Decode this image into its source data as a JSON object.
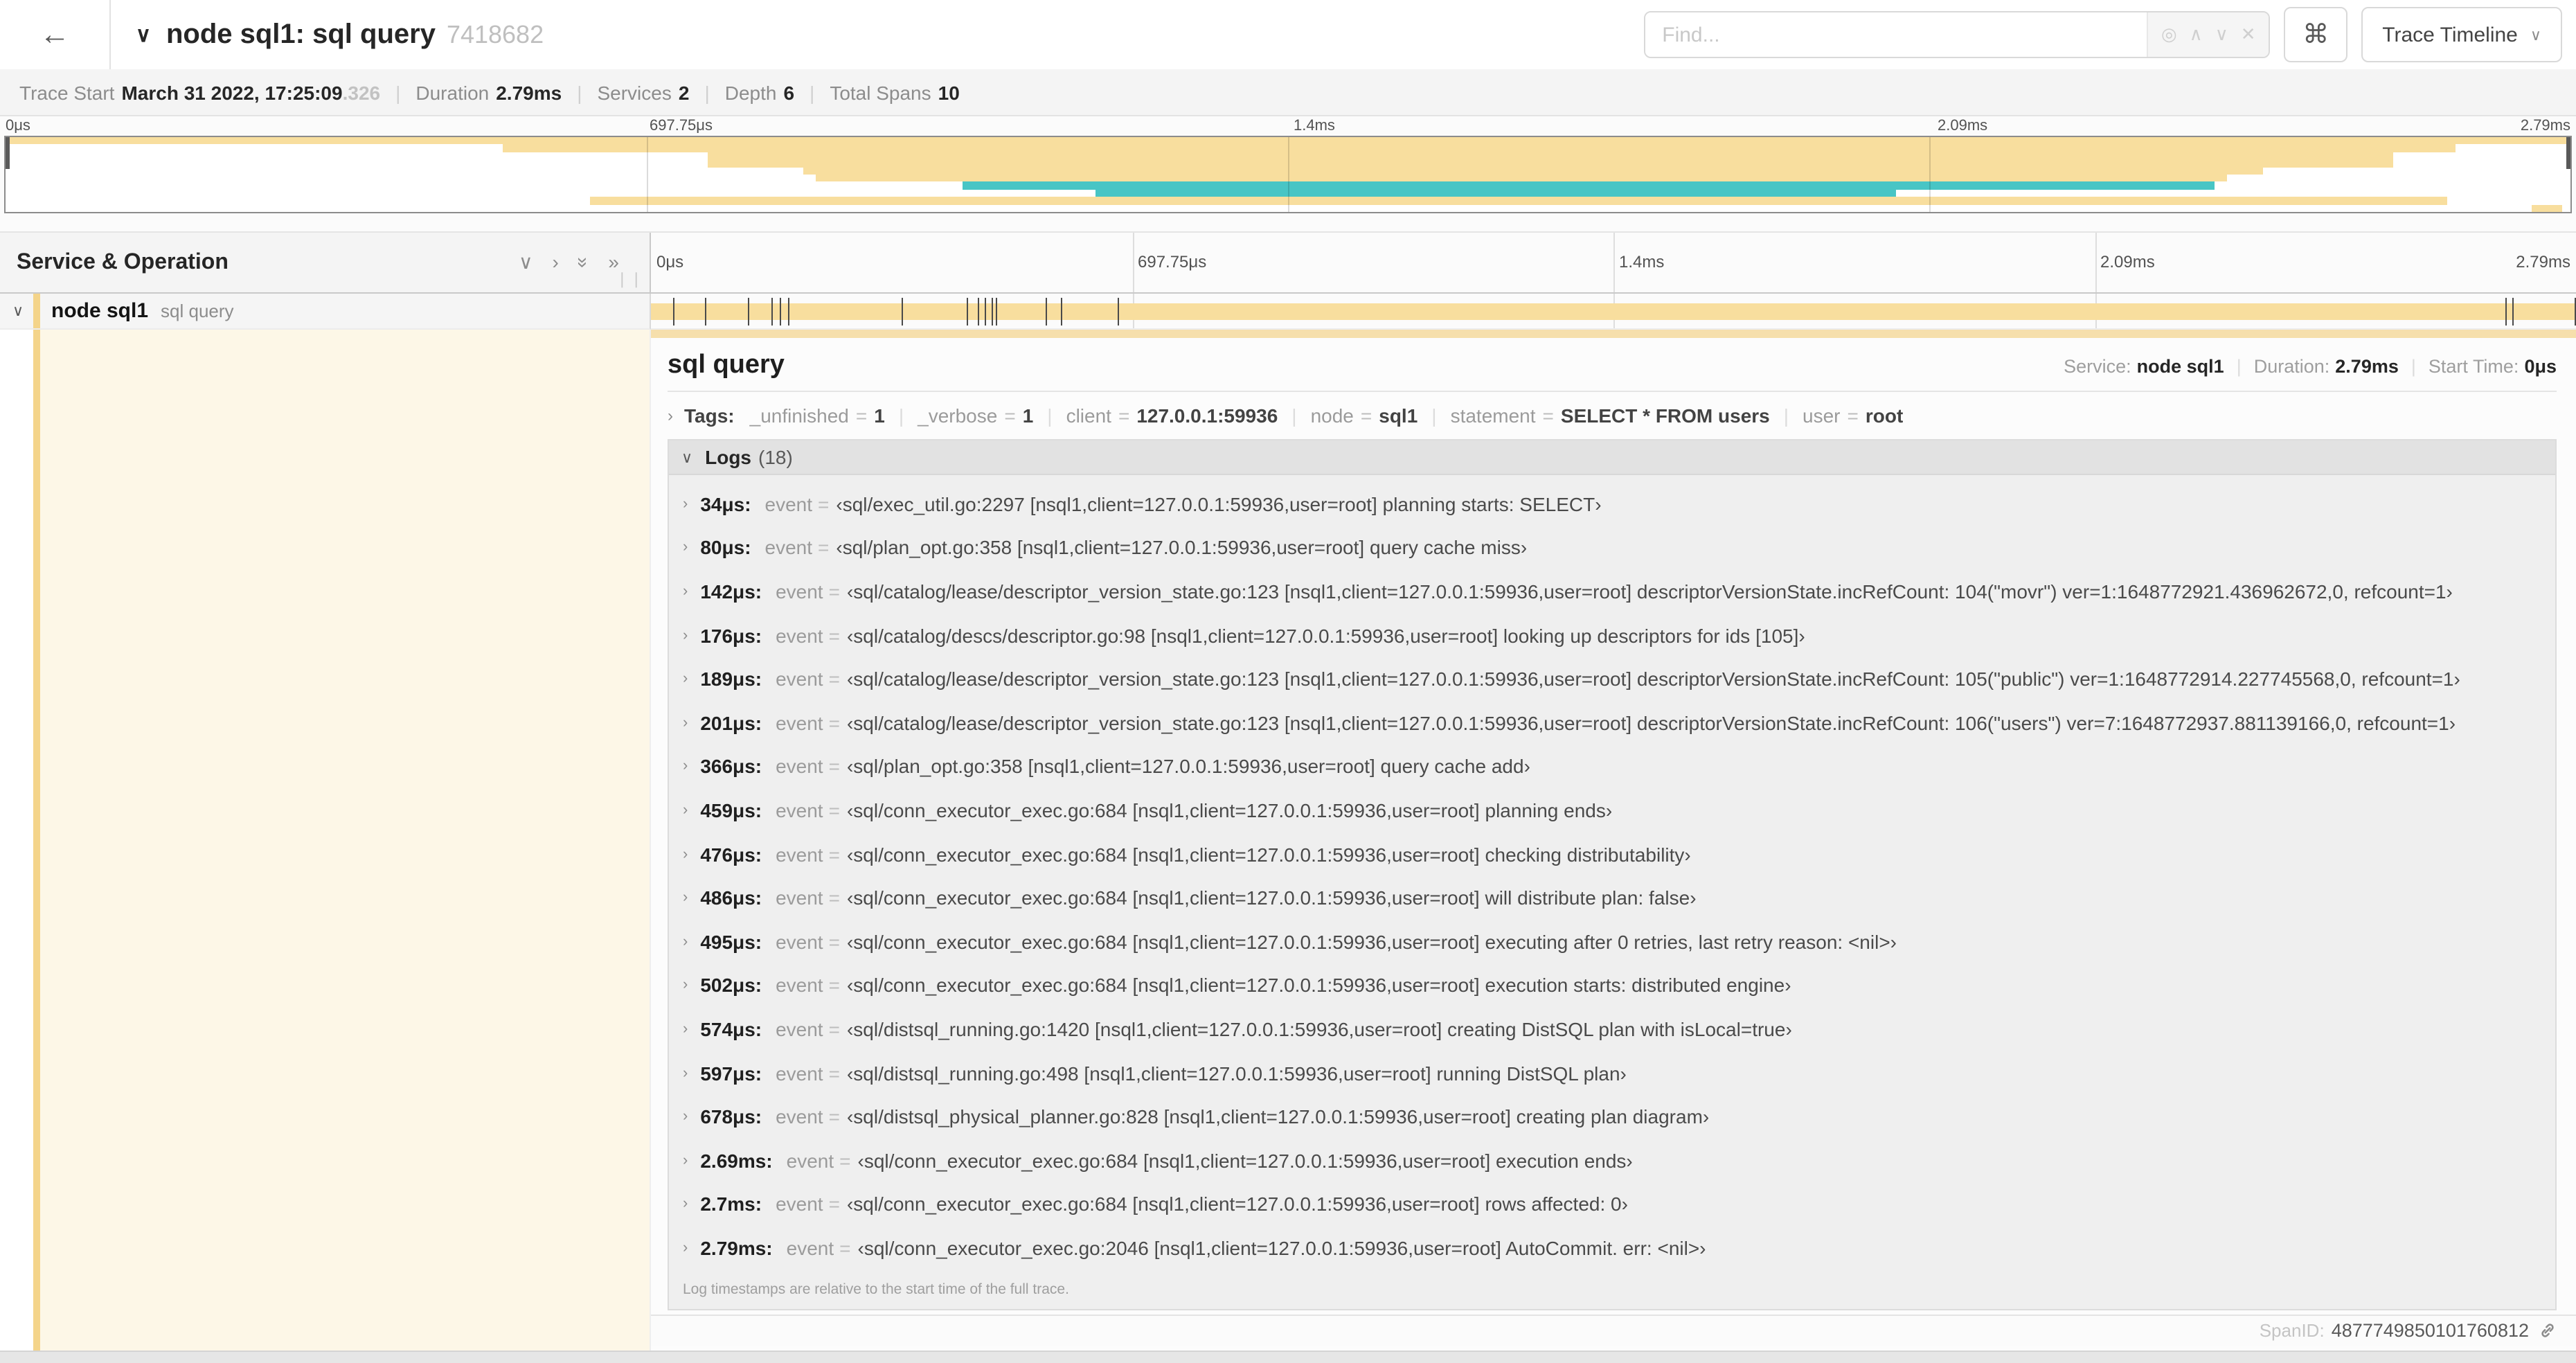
{
  "header": {
    "back_icon": "←",
    "title": "node sql1: sql query",
    "trace_id_short": "7418682",
    "find_placeholder": "Find...",
    "keyboard_shortcut_icon": "⌘",
    "view_selector_label": "Trace Timeline"
  },
  "trace_info": {
    "items": [
      {
        "label": "Trace Start",
        "value": "March 31 2022, 17:25:09",
        "suffix": ".326"
      },
      {
        "label": "Duration",
        "value": "2.79ms",
        "suffix": ""
      },
      {
        "label": "Services",
        "value": "2",
        "suffix": ""
      },
      {
        "label": "Depth",
        "value": "6",
        "suffix": ""
      },
      {
        "label": "Total Spans",
        "value": "10",
        "suffix": ""
      }
    ]
  },
  "timeline": {
    "duration_us": 2790,
    "ticks": [
      {
        "label": "0μs",
        "pos": 0
      },
      {
        "label": "697.75μs",
        "pos": 25
      },
      {
        "label": "1.4ms",
        "pos": 50
      },
      {
        "label": "2.09ms",
        "pos": 75
      },
      {
        "label": "2.79ms",
        "pos": 100
      }
    ],
    "grid_positions": [
      25,
      50,
      75
    ],
    "colors": {
      "tan": "#F8DE9E",
      "teal": "#48C5C5",
      "strip": "#F4D48A",
      "cream": "#FDF7E7",
      "topbar": "#F6DFAC"
    },
    "minimap_spans": [
      {
        "left": 0,
        "width": 100,
        "color": "tan"
      },
      {
        "left": 19.4,
        "width": 76.1,
        "color": "tan"
      },
      {
        "left": 27.4,
        "width": 65.7,
        "color": "tan"
      },
      {
        "left": 27.4,
        "width": 65.7,
        "color": "tan"
      },
      {
        "left": 31.1,
        "width": 56.9,
        "color": "tan"
      },
      {
        "left": 31.6,
        "width": 55.0,
        "color": "tan"
      },
      {
        "left": 37.3,
        "width": 48.8,
        "color": "teal"
      },
      {
        "left": 42.5,
        "width": 31.2,
        "color": "teal"
      },
      {
        "left": 22.8,
        "width": 72.4,
        "color": "tan"
      },
      {
        "left": 98.5,
        "width": 1.2,
        "color": "tan"
      }
    ]
  },
  "span_list": {
    "header": "Service & Operation",
    "row": {
      "service": "node sql1",
      "operation": "sql query"
    }
  },
  "detail": {
    "title": "sql query",
    "overview": [
      {
        "label": "Service:",
        "value": "node sql1"
      },
      {
        "label": "Duration:",
        "value": "2.79ms"
      },
      {
        "label": "Start Time:",
        "value": "0μs"
      }
    ],
    "tags_label": "Tags:",
    "tags": [
      {
        "key": "_unfinished",
        "value": "1"
      },
      {
        "key": "_verbose",
        "value": "1"
      },
      {
        "key": "client",
        "value": "127.0.0.1:59936"
      },
      {
        "key": "node",
        "value": "sql1"
      },
      {
        "key": "statement",
        "value": "SELECT * FROM users"
      },
      {
        "key": "user",
        "value": "root"
      }
    ],
    "logs_label": "Logs",
    "logs_count": "(18)",
    "log_key": "event",
    "logs": [
      {
        "time": "34μs:",
        "t_us": 34,
        "value": "sql/exec_util.go:2297 [nsql1,client=127.0.0.1:59936,user=root] planning starts: SELECT"
      },
      {
        "time": "80μs:",
        "t_us": 80,
        "value": "sql/plan_opt.go:358 [nsql1,client=127.0.0.1:59936,user=root] query cache miss"
      },
      {
        "time": "142μs:",
        "t_us": 142,
        "value": "sql/catalog/lease/descriptor_version_state.go:123 [nsql1,client=127.0.0.1:59936,user=root] descriptorVersionState.incRefCount: 104(\"movr\") ver=1:1648772921.436962672,0, refcount=1"
      },
      {
        "time": "176μs:",
        "t_us": 176,
        "value": "sql/catalog/descs/descriptor.go:98 [nsql1,client=127.0.0.1:59936,user=root] looking up descriptors for ids [105]"
      },
      {
        "time": "189μs:",
        "t_us": 189,
        "value": "sql/catalog/lease/descriptor_version_state.go:123 [nsql1,client=127.0.0.1:59936,user=root] descriptorVersionState.incRefCount: 105(\"public\") ver=1:1648772914.227745568,0, refcount=1"
      },
      {
        "time": "201μs:",
        "t_us": 201,
        "value": "sql/catalog/lease/descriptor_version_state.go:123 [nsql1,client=127.0.0.1:59936,user=root] descriptorVersionState.incRefCount: 106(\"users\") ver=7:1648772937.881139166,0, refcount=1"
      },
      {
        "time": "366μs:",
        "t_us": 366,
        "value": "sql/plan_opt.go:358 [nsql1,client=127.0.0.1:59936,user=root] query cache add"
      },
      {
        "time": "459μs:",
        "t_us": 459,
        "value": "sql/conn_executor_exec.go:684 [nsql1,client=127.0.0.1:59936,user=root] planning ends"
      },
      {
        "time": "476μs:",
        "t_us": 476,
        "value": "sql/conn_executor_exec.go:684 [nsql1,client=127.0.0.1:59936,user=root] checking distributability"
      },
      {
        "time": "486μs:",
        "t_us": 486,
        "value": "sql/conn_executor_exec.go:684 [nsql1,client=127.0.0.1:59936,user=root] will distribute plan: false"
      },
      {
        "time": "495μs:",
        "t_us": 495,
        "value": "sql/conn_executor_exec.go:684 [nsql1,client=127.0.0.1:59936,user=root] executing after 0 retries, last retry reason: <nil>"
      },
      {
        "time": "502μs:",
        "t_us": 502,
        "value": "sql/conn_executor_exec.go:684 [nsql1,client=127.0.0.1:59936,user=root] execution starts: distributed engine"
      },
      {
        "time": "574μs:",
        "t_us": 574,
        "value": "sql/distsql_running.go:1420 [nsql1,client=127.0.0.1:59936,user=root] creating DistSQL plan with isLocal=true"
      },
      {
        "time": "597μs:",
        "t_us": 597,
        "value": "sql/distsql_running.go:498 [nsql1,client=127.0.0.1:59936,user=root] running DistSQL plan"
      },
      {
        "time": "678μs:",
        "t_us": 678,
        "value": "sql/distsql_physical_planner.go:828 [nsql1,client=127.0.0.1:59936,user=root] creating plan diagram"
      },
      {
        "time": "2.69ms:",
        "t_us": 2690,
        "value": "sql/conn_executor_exec.go:684 [nsql1,client=127.0.0.1:59936,user=root] execution ends"
      },
      {
        "time": "2.7ms:",
        "t_us": 2700,
        "value": "sql/conn_executor_exec.go:684 [nsql1,client=127.0.0.1:59936,user=root] rows affected: 0"
      },
      {
        "time": "2.79ms:",
        "t_us": 2790,
        "value": "sql/conn_executor_exec.go:2046 [nsql1,client=127.0.0.1:59936,user=root] AutoCommit. err: <nil>"
      }
    ],
    "logs_footer": "Log timestamps are relative to the start time of the full trace.",
    "span_id_label": "SpanID:",
    "span_id": "4877749850101760812"
  }
}
